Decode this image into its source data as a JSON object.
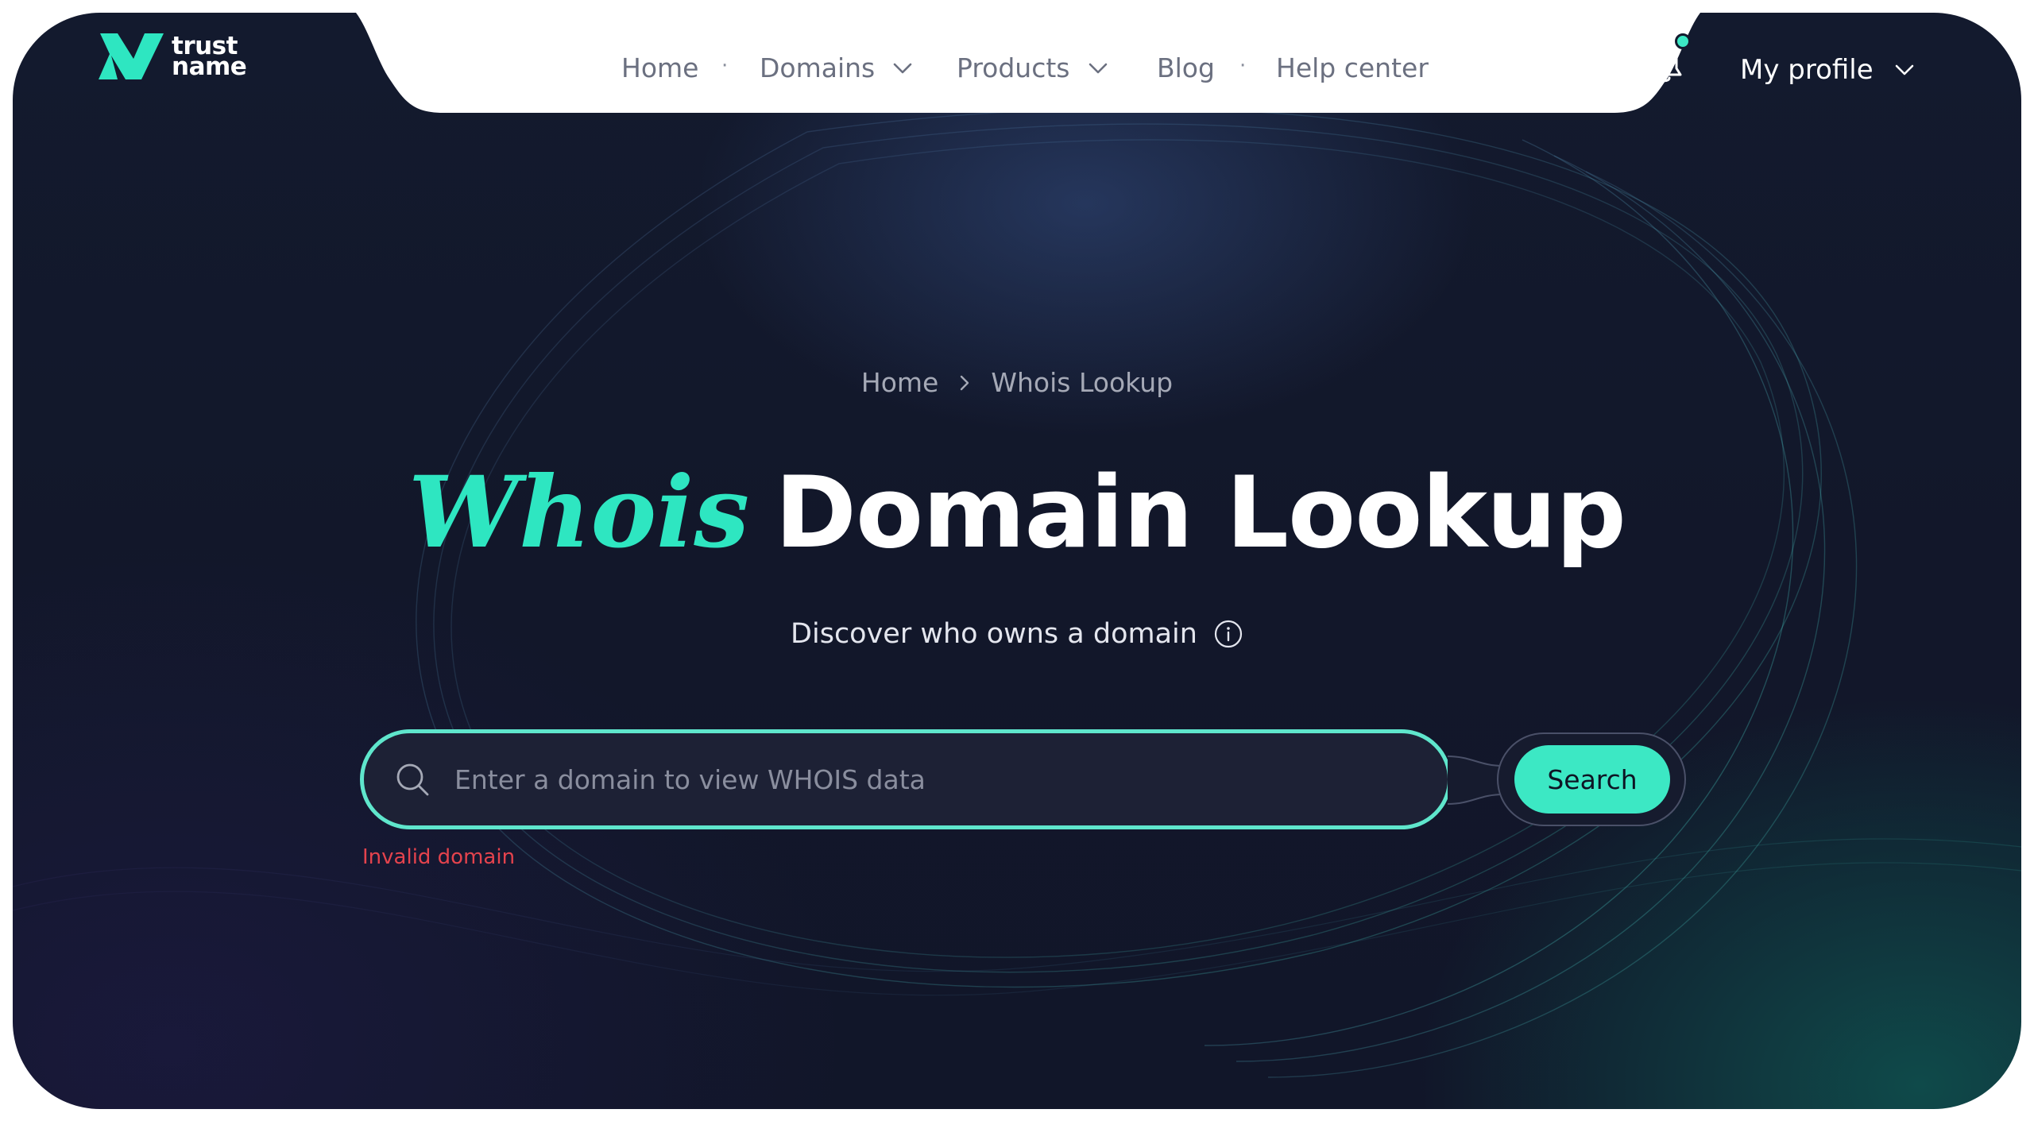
{
  "logo": {
    "line1": "trust",
    "line2": "name"
  },
  "nav": {
    "items": [
      {
        "label": "Home",
        "has_dropdown": false
      },
      {
        "label": "Domains",
        "has_dropdown": true
      },
      {
        "label": "Products",
        "has_dropdown": true
      },
      {
        "label": "Blog",
        "has_dropdown": false
      },
      {
        "label": "Help center",
        "has_dropdown": false
      }
    ],
    "separator": "·"
  },
  "header": {
    "notification_icon": "bell-icon",
    "notification_badge": true,
    "profile_label": "My profile"
  },
  "breadcrumb": {
    "items": [
      "Home",
      "Whois Lookup"
    ]
  },
  "hero": {
    "title_accent": "Whois",
    "title_rest": "Domain Lookup",
    "subtitle": "Discover who owns a domain",
    "subtitle_icon": "info-icon"
  },
  "search": {
    "placeholder": "Enter a domain to view WHOIS data",
    "value": "",
    "button_label": "Search",
    "error": "Invalid domain"
  },
  "colors": {
    "accent": "#3ce8c4",
    "background": "#131a2e",
    "error": "#e4434d",
    "nav_bg": "#ffffff"
  }
}
